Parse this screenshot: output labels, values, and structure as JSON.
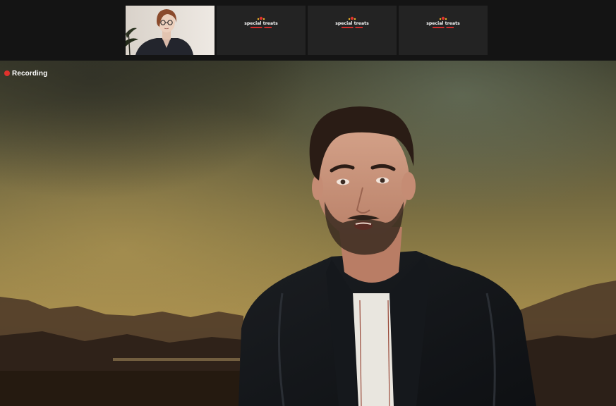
{
  "meeting": {
    "recording_label": "Recording",
    "colors": {
      "recording_dot": "#e0322c",
      "top_bar": "#141414",
      "tile_background": "#232323"
    }
  },
  "participants": [
    {
      "kind": "camera",
      "icon": "participant-webcam"
    },
    {
      "kind": "logo",
      "logo_text": "special treats"
    },
    {
      "kind": "logo",
      "logo_text": "special treats"
    },
    {
      "kind": "logo",
      "logo_text": "special treats"
    }
  ],
  "main_speaker": {
    "kind": "camera",
    "scene": "speaker-on-painted-landscape-backdrop"
  }
}
